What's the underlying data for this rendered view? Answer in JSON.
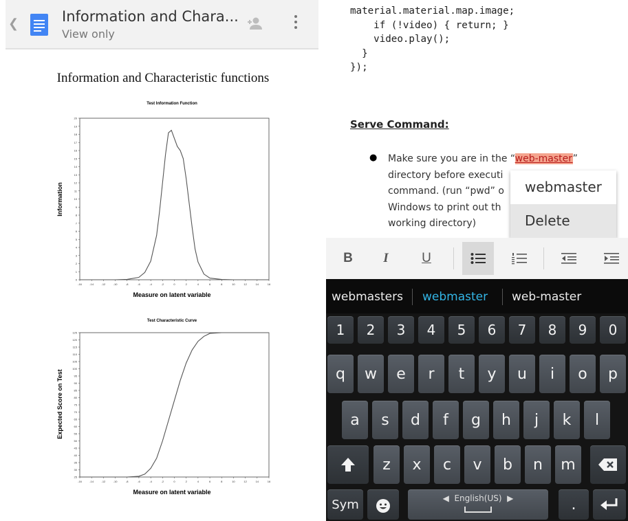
{
  "doc_header": {
    "back_icon": "chevron-left-icon",
    "title": "Information and Chara...",
    "subtitle": "View only",
    "add_person_icon": "add-person-icon",
    "menu_icon": "more-vert-icon"
  },
  "doc": {
    "heading": "Information and Characteristic functions"
  },
  "chart_data": [
    {
      "type": "line",
      "title": "Test Information Function",
      "xlabel": "Measure on latent variable",
      "ylabel": "Information",
      "xlim": [
        -16,
        16
      ],
      "ylim": [
        0,
        20
      ],
      "x_ticks": [
        "-16",
        "-14",
        "-12",
        "-10",
        "-8",
        "-6",
        "-4",
        "-2",
        "0",
        "2",
        "4",
        "6",
        "8",
        "10",
        "12",
        "14",
        "16"
      ],
      "y_ticks": [
        "0",
        "1",
        "2",
        "3",
        "4",
        "5",
        "6",
        "7",
        "8",
        "9",
        "10",
        "11",
        "12",
        "13",
        "14",
        "15",
        "16",
        "17",
        "18",
        "19",
        "20"
      ],
      "series": [
        {
          "x": [
            -16,
            -10,
            -8,
            -6,
            -5,
            -4,
            -3,
            -2.5,
            -2,
            -1.5,
            -1,
            -0.5,
            0,
            0.5,
            1,
            1.5,
            2,
            2.5,
            3,
            3.5,
            4,
            5,
            6,
            8,
            10,
            16
          ],
          "y": [
            0,
            0,
            0.05,
            0.3,
            0.9,
            2.3,
            5.5,
            8.5,
            12,
            15.5,
            18.2,
            18.5,
            17.5,
            16.5,
            16.0,
            15.0,
            12.5,
            9.5,
            6.5,
            3.8,
            2.2,
            0.7,
            0.2,
            0.03,
            0,
            0
          ]
        }
      ]
    },
    {
      "type": "line",
      "title": "Test Characteristic Curve",
      "xlabel": "Measure on latent variable",
      "ylabel": "Expected Score on Test",
      "xlim": [
        -16,
        16
      ],
      "ylim": [
        25,
        125
      ],
      "x_ticks": [
        "-16",
        "-14",
        "-12",
        "-10",
        "-8",
        "-6",
        "-4",
        "-2",
        "0",
        "2",
        "4",
        "6",
        "8",
        "10",
        "12",
        "14",
        "16"
      ],
      "y_ticks": [
        "25",
        "30",
        "35",
        "40",
        "45",
        "50",
        "55",
        "60",
        "65",
        "70",
        "75",
        "80",
        "85",
        "90",
        "95",
        "100",
        "105",
        "110",
        "115",
        "120",
        "125"
      ],
      "series": [
        {
          "x": [
            -16,
            -8,
            -6,
            -5,
            -4,
            -3,
            -2,
            -1,
            0,
            1,
            2,
            3,
            4,
            5,
            6,
            8,
            16
          ],
          "y": [
            25,
            25,
            25.5,
            27,
            31,
            38,
            50,
            64,
            78,
            92,
            104,
            113,
            119,
            122.5,
            124.5,
            125,
            125
          ]
        }
      ]
    }
  ],
  "code_lines": [
    "material.material.map.image;",
    "    if (!video) { return; }",
    "    video.play();",
    "  }",
    "});"
  ],
  "section": {
    "heading": "Serve Command:",
    "bullet_pre": "Make sure you are in the “",
    "bullet_highlight": "web-master",
    "bullet_post": "”",
    "line2": "directory before executi",
    "line3": "command.  (run “pwd” o",
    "line4": "Windows to print out th",
    "line5": "working directory)"
  },
  "popup": {
    "items": [
      "webmaster",
      "Delete"
    ]
  },
  "format_toolbar": {
    "bold": "B",
    "italic": "I",
    "underline": "U",
    "bullet_list_icon": "bullet-list-icon",
    "numbered_list_icon": "numbered-list-icon",
    "decrease_indent_icon": "decrease-indent-icon",
    "increase_indent_icon": "increase-indent-icon"
  },
  "keyboard": {
    "suggestions": [
      "webmasters",
      "webmaster",
      "web-master"
    ],
    "suggestion_selected_color": "#33b5e5",
    "number_row": [
      "1",
      "2",
      "3",
      "4",
      "5",
      "6",
      "7",
      "8",
      "9",
      "0"
    ],
    "row1": [
      "q",
      "w",
      "e",
      "r",
      "t",
      "y",
      "u",
      "i",
      "o",
      "p"
    ],
    "row2": [
      "a",
      "s",
      "d",
      "f",
      "g",
      "h",
      "j",
      "k",
      "l"
    ],
    "row3": [
      "z",
      "x",
      "c",
      "v",
      "b",
      "n",
      "m"
    ],
    "sym_label": "Sym",
    "space_label": "English(US)",
    "period_label": ".",
    "shift_icon": "shift-icon",
    "backspace_icon": "backspace-icon",
    "enter_icon": "enter-icon",
    "emoji_icon": "emoji-icon"
  }
}
